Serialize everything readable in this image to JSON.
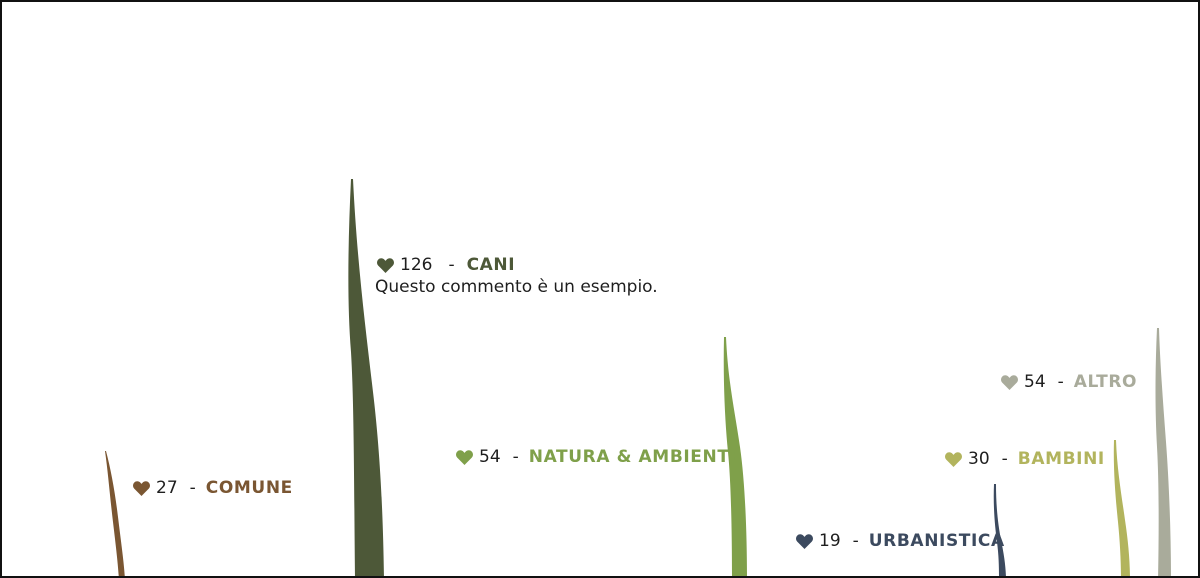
{
  "colors": {
    "cani": "#4d5838",
    "natura": "#7fa04a",
    "comune": "#7a5632",
    "urbanistica": "#3c4a5f",
    "bambini": "#b2b45d",
    "altro": "#a9ab9b",
    "text": "#1e1e1e",
    "border": "#111111"
  },
  "posts": [
    {
      "key": "comune",
      "icon": "heart-icon",
      "count": "27",
      "separator": "-",
      "category": "COMUNE",
      "color": "#7a5632"
    },
    {
      "key": "cani",
      "icon": "heart-icon",
      "count": "126",
      "separator": "-",
      "category": "CANI",
      "color": "#4d5838",
      "comment": "Questo commento è un esempio."
    },
    {
      "key": "natura",
      "icon": "heart-icon",
      "count": "54",
      "separator": "-",
      "category": "NATURA & AMBIENTE",
      "color": "#7fa04a"
    },
    {
      "key": "urbanistica",
      "icon": "heart-icon",
      "count": "19",
      "separator": "-",
      "category": "URBANISTICA",
      "color": "#3c4a5f"
    },
    {
      "key": "bambini",
      "icon": "heart-icon",
      "count": "30",
      "separator": "-",
      "category": "BAMBINI",
      "color": "#b2b45d"
    },
    {
      "key": "altro",
      "icon": "heart-icon",
      "count": "54",
      "separator": "-",
      "category": "ALTRO",
      "color": "#a9ab9b"
    }
  ]
}
